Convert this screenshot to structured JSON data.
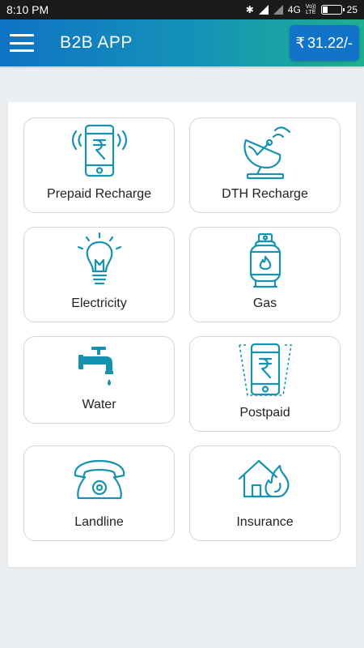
{
  "status_bar": {
    "time": "8:10 PM",
    "network": "4G",
    "volte_line1": "Vo))",
    "volte_line2": "LTE",
    "battery": "25"
  },
  "app_bar": {
    "title": "B2B APP",
    "menu_icon": "hamburger-menu-icon",
    "wallet_symbol": "₹",
    "wallet_balance": "31.22/-"
  },
  "services": [
    {
      "label": "Prepaid Recharge",
      "icon": "mobile-recharge-icon"
    },
    {
      "label": "DTH Recharge",
      "icon": "satellite-dish-icon"
    },
    {
      "label": "Electricity",
      "icon": "light-bulb-icon"
    },
    {
      "label": "Gas",
      "icon": "gas-cylinder-icon"
    },
    {
      "label": "Water",
      "icon": "water-tap-icon"
    },
    {
      "label": "Postpaid",
      "icon": "postpaid-phone-icon"
    },
    {
      "label": "Landline",
      "icon": "landline-phone-icon"
    },
    {
      "label": "Insurance",
      "icon": "home-insurance-icon"
    }
  ],
  "colors": {
    "accent": "#1592b0",
    "app_bar_start": "#0f73c4",
    "app_bar_end": "#1fb091",
    "wallet_bg": "#1274c8",
    "background": "#eceff1"
  }
}
